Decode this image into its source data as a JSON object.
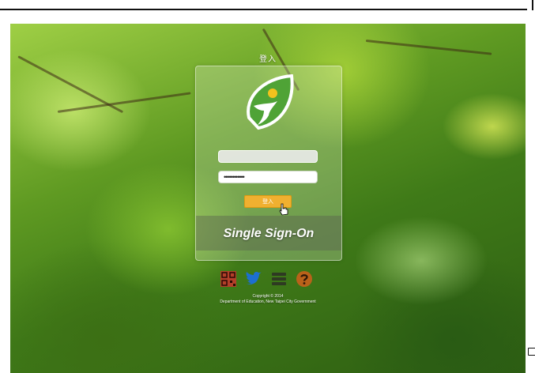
{
  "page": {
    "title": "登入"
  },
  "login": {
    "username_value": "",
    "password_value": "••••••••••••",
    "button_label": "登入"
  },
  "banner": {
    "text": "Single Sign-On"
  },
  "icons": [
    {
      "name": "qr-code-icon",
      "color": "#c0392b"
    },
    {
      "name": "twitter-bird-icon",
      "color": "#1d6fd0"
    },
    {
      "name": "menu-icon",
      "color": "#2e3a22"
    },
    {
      "name": "help-icon",
      "color": "#b9621a"
    }
  ],
  "footer": {
    "copyright": "Copyright © 2014",
    "organization": "Department of Education, New Taipei City Government"
  },
  "colors": {
    "button": "#f0b030",
    "logo_green": "#4fa336",
    "logo_accent": "#f2c21d"
  }
}
